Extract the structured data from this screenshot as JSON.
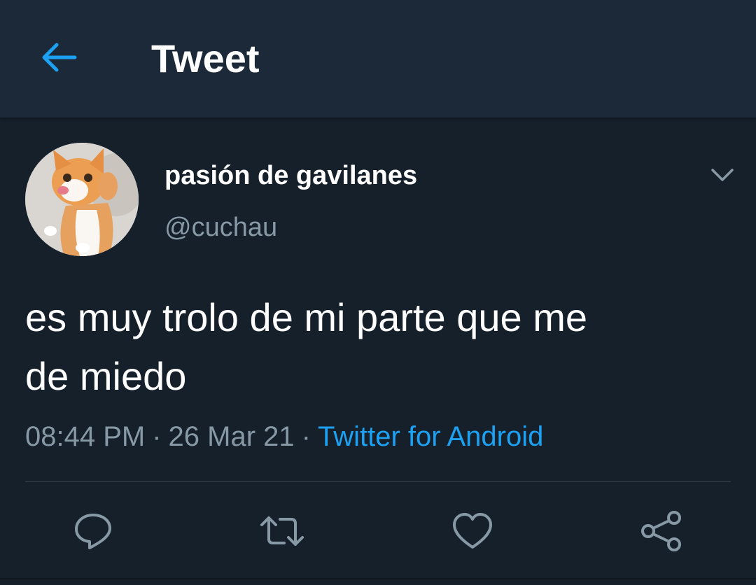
{
  "header": {
    "back_icon": "arrow-left-icon",
    "title": "Tweet"
  },
  "tweet": {
    "author": {
      "display_name": "pasión de gavilanes",
      "handle": "@cuchau",
      "avatar": "cat-photo-avatar"
    },
    "menu_icon": "chevron-down-icon",
    "text": "es muy trolo de mi parte que me\nde miedo",
    "time": "08:44 PM",
    "separator": "·",
    "date": "26 Mar 21",
    "source": "Twitter for Android"
  },
  "actions": [
    {
      "name": "reply",
      "icon": "reply-icon"
    },
    {
      "name": "retweet",
      "icon": "retweet-icon"
    },
    {
      "name": "like",
      "icon": "heart-icon"
    },
    {
      "name": "share",
      "icon": "share-icon"
    }
  ],
  "colors": {
    "background": "#15202b",
    "header_background": "#1c2938",
    "accent": "#1da1f2",
    "secondary_text": "#8899a6",
    "divider": "#38444d"
  }
}
